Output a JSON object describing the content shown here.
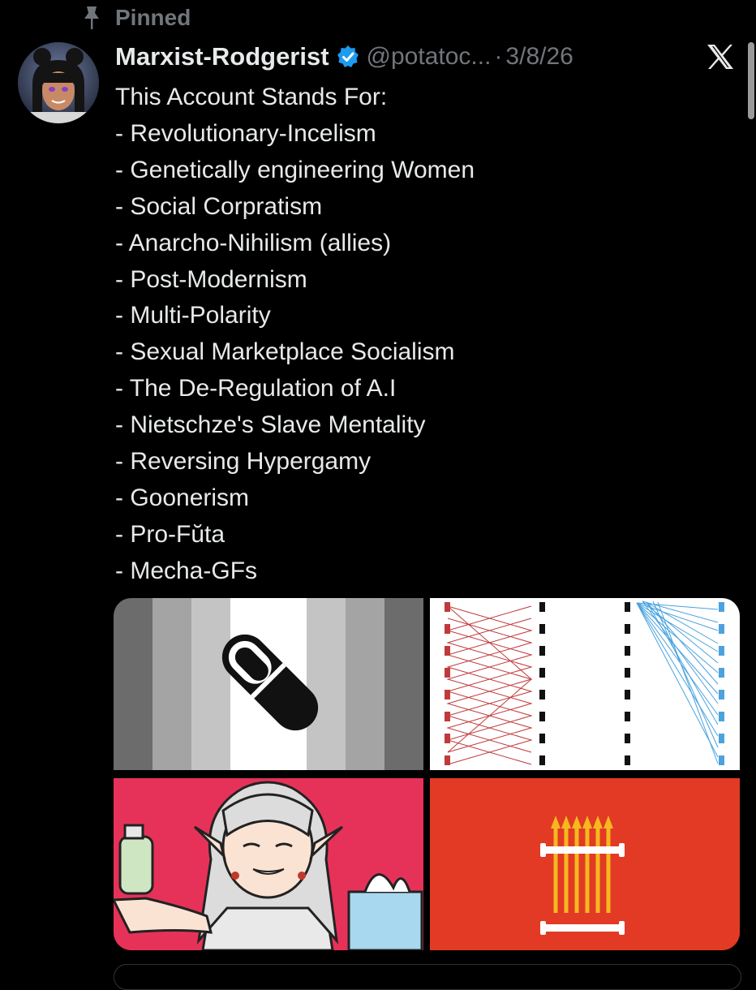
{
  "pinned": {
    "label": "Pinned",
    "icon": "pin-icon"
  },
  "author": {
    "display_name": "Marxist-Rodgerist",
    "verified_icon": "verified-badge-icon",
    "handle": "@potatoc...",
    "separator": "·",
    "date": "3/8/26",
    "brand_icon": "x-logo-icon"
  },
  "post": {
    "lines": [
      "This Account Stands For:",
      "- Revolutionary-Incelism",
      "- Genetically engineering Women",
      "- Social Corpratism",
      "- Anarcho-Nihilism (allies)",
      "- Post-Modernism",
      "- Multi-Polarity",
      "- Sexual Marketplace Socialism",
      "- The De-Regulation of A.I",
      "- Nietschze's Slave Mentality",
      "- Reversing Hypergamy",
      "- Goonerism",
      "- Pro-Fŭta",
      "- Mecha-GFs"
    ]
  },
  "colors": {
    "background": "#000000",
    "text": "#e7e9ea",
    "muted": "#71767b",
    "verified_blue": "#1d9bf0",
    "tile_pink": "#e63259",
    "tile_red": "#e23a24",
    "arrow_red": "#c0393b",
    "arrow_blue": "#4aa3df",
    "gold": "#f5b81f"
  },
  "media": [
    {
      "kind": "image",
      "subject": "grayscale striped flag with black pill icon"
    },
    {
      "kind": "image",
      "subject": "diagram of red and blue figures with connecting lines"
    },
    {
      "kind": "image",
      "subject": "anime elf character holding bottle and tissue box"
    },
    {
      "kind": "image",
      "subject": "red flag with gold arrows and white fence"
    }
  ]
}
